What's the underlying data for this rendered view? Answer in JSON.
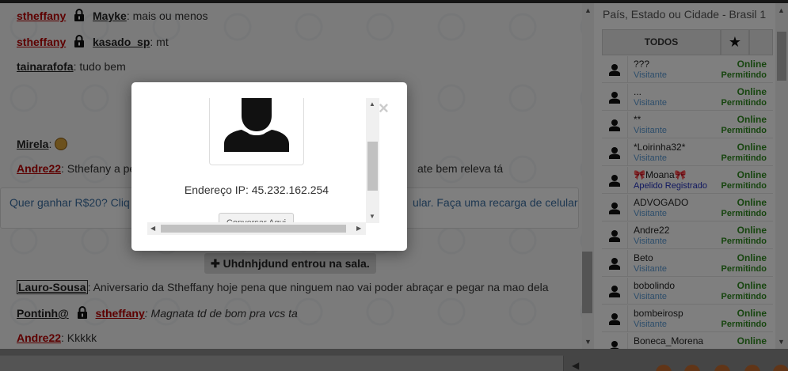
{
  "chat": {
    "messages": [
      {
        "nick": "stheffany",
        "to": "Mayke",
        "text": ": mais ou menos",
        "private": true
      },
      {
        "nick": "stheffany",
        "to": "kasado_sp",
        "text": ": mt",
        "private": true
      },
      {
        "nick": "tainarafofa",
        "text": ": tudo bem"
      },
      {
        "nick": "Mirela",
        "text": ":"
      },
      {
        "nick": "Andre22",
        "text_left": ": Sthefany a pe",
        "text_right": "ate bem releva tá"
      },
      {
        "nick": "Lauro-Sousa",
        "text": ": Aniversario da Stheffany hoje pena que ninguem nao vai poder abraçar e pegar na mao dela"
      },
      {
        "nick": "Pontinh@",
        "to": "stheffany",
        "text": ": Magnata td de bom pra vcs ta",
        "private": true
      },
      {
        "nick": "Andre22",
        "text": ": Kkkkk"
      }
    ],
    "promo_left": "Quer ganhar R$20? Cliq",
    "promo_right": "ular. Faça uma recarga de celular",
    "system_text": "Uhdnhjdund entrou na sala."
  },
  "panel": {
    "title": "País, Estado ou Cidade - Brasil 1",
    "tab_all": "TODOS",
    "tab_star": "★",
    "users": [
      {
        "name": "???",
        "sub": "Visitante",
        "status": "Online",
        "perm": "Permitindo"
      },
      {
        "name": "...",
        "sub": "Visitante",
        "status": "Online",
        "perm": "Permitindo"
      },
      {
        "name": "**",
        "sub": "Visitante",
        "status": "Online",
        "perm": "Permitindo"
      },
      {
        "name": "*Loirinha32*",
        "sub": "Visitante",
        "status": "Online",
        "perm": "Permitindo"
      },
      {
        "name": "🎀Moana🎀",
        "sub": "Apelido Registrado",
        "status": "Online",
        "perm": "Permitindo",
        "registered": true
      },
      {
        "name": "ADVOGADO",
        "sub": "Visitante",
        "status": "Online",
        "perm": "Permitindo"
      },
      {
        "name": "Andre22",
        "sub": "Visitante",
        "status": "Online",
        "perm": "Permitindo"
      },
      {
        "name": "Beto",
        "sub": "Visitante",
        "status": "Online",
        "perm": "Permitindo"
      },
      {
        "name": "bobolindo",
        "sub": "Visitante",
        "status": "Online",
        "perm": "Permitindo"
      },
      {
        "name": "bombeirosp",
        "sub": "Visitante",
        "status": "Online",
        "perm": "Permitindo"
      },
      {
        "name": "Boneca_Morena",
        "sub": "",
        "status": "Online",
        "perm": ""
      }
    ]
  },
  "modal": {
    "ip_text": "Endereço IP: 45.232.162.254",
    "button_label": "Conversar Aqui",
    "close": "×"
  },
  "colors": {
    "nick_red": "#bb0000",
    "online_green": "#2e8b1f",
    "visitor_blue": "#5b9bd5",
    "promo_blue": "#3a6fa3"
  }
}
